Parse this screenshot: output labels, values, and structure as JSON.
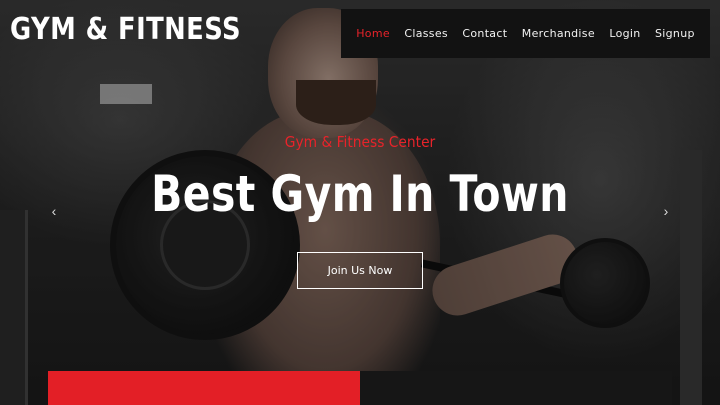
{
  "brand": {
    "logo": "GYM & FITNESS"
  },
  "nav": {
    "items": [
      {
        "label": "Home",
        "active": true
      },
      {
        "label": "Classes"
      },
      {
        "label": "Contact"
      },
      {
        "label": "Merchandise"
      },
      {
        "label": "Login"
      },
      {
        "label": "Signup"
      }
    ]
  },
  "hero": {
    "subtitle": "Gym & Fitness Center",
    "title": "Best Gym In Town",
    "cta_label": "Join Us Now"
  },
  "carousel": {
    "prev_icon": "chevron-left-icon",
    "next_icon": "chevron-right-icon",
    "prev_glyph": "‹",
    "next_glyph": "›"
  },
  "colors": {
    "accent": "#e8232a",
    "nav_bg": "#121212",
    "bottom_red": "#e31f26",
    "bottom_dark": "#161616"
  }
}
